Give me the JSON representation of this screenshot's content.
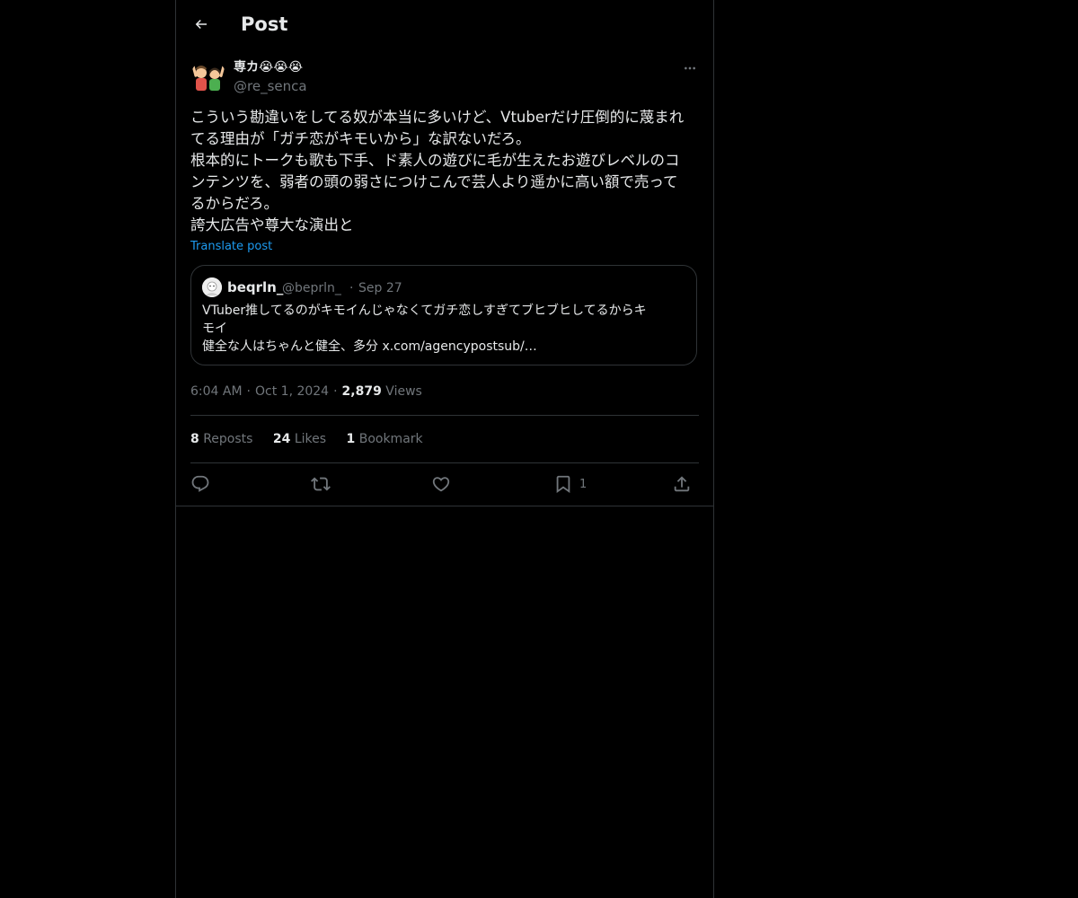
{
  "header": {
    "title": "Post"
  },
  "post": {
    "display_name": "専カ😭😭😭",
    "handle": "@re_senca",
    "text_lines": [
      "こういう勘違いをしてる奴が本当に多いけど、Vtuberだけ圧倒的に蔑まれ",
      "てる理由が「ガチ恋がキモいから」な訳ないだろ。",
      "根本的にトークも歌も下手、ド素人の遊びに毛が生えたお遊びレベルのコ",
      "ンテンツを、弱者の頭の弱さにつけこんで芸人より遥かに高い額で売って",
      "るからだろ。",
      "誇大広告や尊大な演出と"
    ],
    "translate_label": "Translate post",
    "time": "6:04 AM",
    "date": "Oct 1, 2024",
    "views_count": "2,879",
    "views_label": "Views"
  },
  "quote": {
    "name": "beqrln_",
    "handle": "@beprln_",
    "dot": "·",
    "date": "Sep 27",
    "text_lines": [
      "VTuber推してるのがキモイんじゃなくてガチ恋しすぎてブヒブヒしてるからキ",
      "モイ",
      "健全な人はちゃんと健全、多分 x.com/agencypostsub/…"
    ]
  },
  "stats": {
    "reposts_count": "8",
    "reposts_label": "Reposts",
    "likes_count": "24",
    "likes_label": "Likes",
    "bookmarks_count": "1",
    "bookmarks_label": "Bookmark"
  },
  "actions": {
    "reply_icon": "reply-icon",
    "repost_icon": "repost-icon",
    "like_icon": "heart-icon",
    "bookmark_icon": "bookmark-icon",
    "bookmark_count": "1",
    "share_icon": "share-icon"
  },
  "colors": {
    "background": "#000000",
    "text": "#e7e9ea",
    "muted": "#71767b",
    "border": "#2f3336",
    "link": "#1d9bf0"
  }
}
